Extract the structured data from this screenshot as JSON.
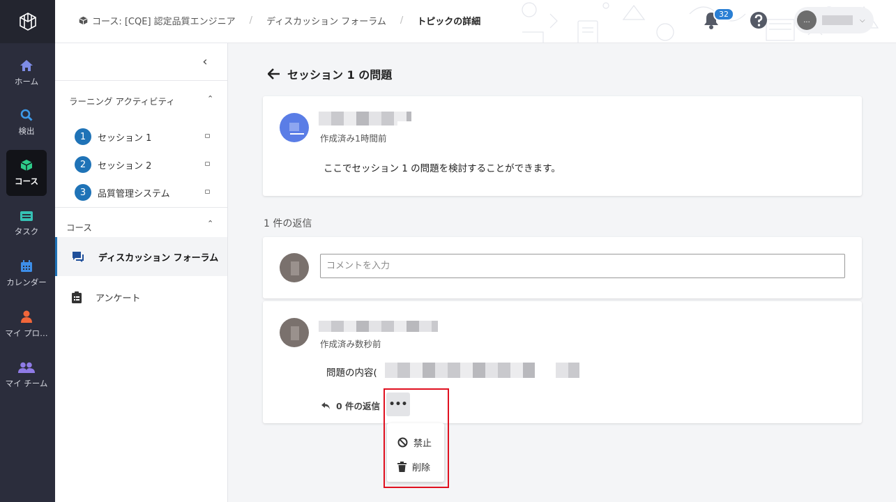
{
  "nav": {
    "items": [
      {
        "label": "ホーム",
        "icon": "home-icon"
      },
      {
        "label": "検出",
        "icon": "search-icon"
      },
      {
        "label": "コース",
        "icon": "cube-icon",
        "active": true
      },
      {
        "label": "タスク",
        "icon": "task-list-icon"
      },
      {
        "label": "カレンダー",
        "icon": "calendar-icon"
      },
      {
        "label": "マイ プロ…",
        "icon": "user-icon"
      },
      {
        "label": "マイ チーム",
        "icon": "team-icon"
      }
    ]
  },
  "header": {
    "breadcrumb": [
      "コース: [CQE] 認定品質エンジニア",
      "ディスカッション フォーラム",
      "トピックの詳細"
    ],
    "notification_count": "32",
    "user_avatar_text": "..."
  },
  "sidebar": {
    "section1_title": "ラーニング アクティビティ",
    "sessions": [
      {
        "num": "1",
        "label": "セッション 1"
      },
      {
        "num": "2",
        "label": "セッション 2"
      },
      {
        "num": "3",
        "label": "品質管理システム"
      }
    ],
    "section2_title": "コース",
    "links": [
      {
        "label": "ディスカッション フォーラム",
        "active": true
      },
      {
        "label": "アンケート"
      }
    ]
  },
  "topic": {
    "title": "セッション 1 の問題",
    "post_meta": "作成済み1時間前",
    "post_body": "ここでセッション 1 の問題を検討することができます。"
  },
  "replies": {
    "count_label": "1 件の返信",
    "comment_placeholder": "コメントを入力",
    "reply_meta": "作成済み数秒前",
    "reply_body_prefix": "問題の内容(",
    "reply_count_label": "0 件の返信",
    "more_label": "•••",
    "menu": {
      "ban_label": "禁止",
      "delete_label": "削除"
    }
  },
  "colors": {
    "accent": "#1f73b7",
    "rail_bg": "#2b2d3c",
    "highlight": "#e0101f"
  }
}
